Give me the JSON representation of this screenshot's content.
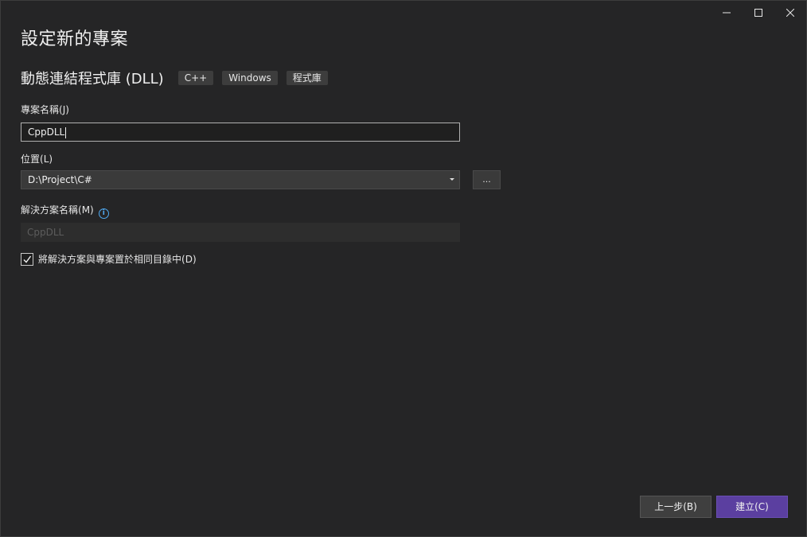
{
  "window": {
    "minimize_icon": "minimize-icon",
    "maximize_icon": "maximize-icon",
    "close_icon": "close-icon"
  },
  "header": {
    "title": "設定新的專案"
  },
  "template": {
    "name": "動態連結程式庫 (DLL)",
    "tags": [
      "C++",
      "Windows",
      "程式庫"
    ]
  },
  "project_name": {
    "label": "專案名稱",
    "accel": "(J)",
    "value": "CppDLL"
  },
  "location": {
    "label": "位置",
    "accel": "(L)",
    "value": "D:\\Project\\C#",
    "browse_label": "..."
  },
  "solution_name": {
    "label": "解決方案名稱",
    "accel": "(M)",
    "info_icon": "info-icon",
    "placeholder": "CppDLL"
  },
  "same_directory": {
    "label": "將解決方案與專案置於相同目錄中",
    "accel": "(D)",
    "checked": true
  },
  "footer": {
    "back_label": "上一步",
    "back_accel": "(B)",
    "create_label": "建立",
    "create_accel": "(C)"
  },
  "colors": {
    "background": "#252526",
    "accent": "#5b3fa0",
    "info": "#4fa9f0"
  }
}
